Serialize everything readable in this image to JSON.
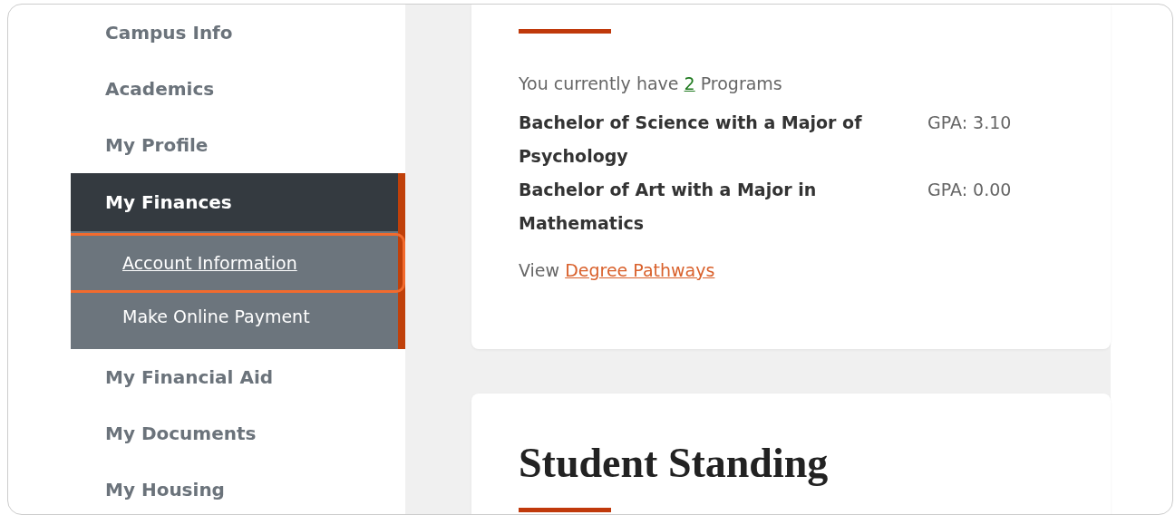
{
  "sidebar": {
    "items": [
      {
        "label": "Campus Info",
        "selected": false
      },
      {
        "label": "Academics",
        "selected": false
      },
      {
        "label": "My Profile",
        "selected": false
      },
      {
        "label": "My Finances",
        "selected": true,
        "expanded": true,
        "children": [
          {
            "label": "Account Information",
            "selected": true
          },
          {
            "label": "Make Online Payment",
            "selected": false
          }
        ]
      },
      {
        "label": "My Financial Aid",
        "selected": false
      },
      {
        "label": "My Documents",
        "selected": false
      },
      {
        "label": "My Housing",
        "selected": false
      }
    ]
  },
  "programs_card": {
    "count_prefix": "You currently have",
    "count": "2",
    "count_suffix": "Programs",
    "programs": [
      {
        "name": "Bachelor of Science with a Major of Psychology",
        "gpa": "GPA: 3.10"
      },
      {
        "name": "Bachelor of Art with a Major in Mathematics",
        "gpa": "GPA: 0.00"
      }
    ],
    "view_prefix": "View",
    "view_link": "Degree Pathways"
  },
  "standing_card": {
    "title": "Student Standing"
  }
}
